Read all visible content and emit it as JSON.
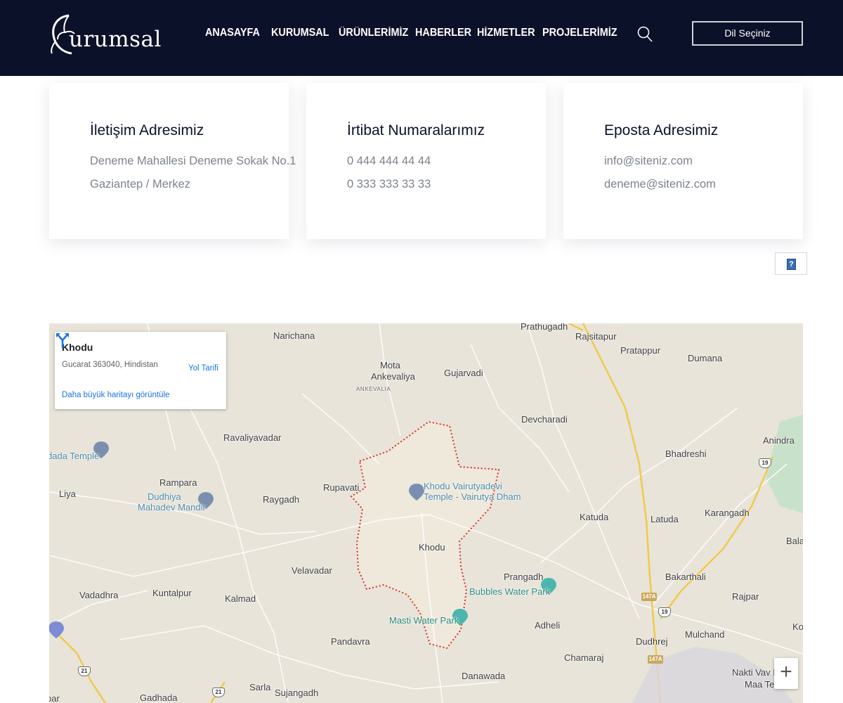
{
  "header": {
    "logo_text": "urumsal",
    "nav": [
      {
        "label": "ANASAYFA",
        "name": "nav-anasayfa"
      },
      {
        "label": "KURUMSAL",
        "name": "nav-kurumsal"
      },
      {
        "label": "ÜRÜNLERİMİZ",
        "name": "nav-urunlerimiz"
      },
      {
        "label": "HABERLER",
        "name": "nav-haberler"
      },
      {
        "label": "HİZMETLER",
        "name": "nav-hizmetler"
      },
      {
        "label": "PROJELERİMİZ",
        "name": "nav-projelerimiz"
      }
    ],
    "search_icon": "search-icon",
    "language_button": "Dil Seçiniz"
  },
  "cards": [
    {
      "title": "İletişim Adresimiz",
      "line1": "Deneme Mahallesi Deneme Sokak No.1",
      "line2": "Gaziantep / Merkez"
    },
    {
      "title": "İrtibat Numaralarımız",
      "line1": "0 444 444 44 44",
      "line2": "0 333 333 33 33"
    },
    {
      "title": "Eposta Adresimiz",
      "line1": "info@siteniz.com",
      "line2": "deneme@siteniz.com"
    }
  ],
  "help_icon": "help-icon",
  "map": {
    "info": {
      "title": "Khodu",
      "address": "Gucarat 363040, Hindistan",
      "directions_label": "Yol Tarifi",
      "larger_map_link": "Daha büyük haritayı görüntüle"
    },
    "zoom_in": "+",
    "places": {
      "prathugadh": "Prathugadh",
      "rajsitapur": "Rajsitapur",
      "narichana": "Narichana",
      "pratappur": "Pratappur",
      "dumana": "Dumana",
      "mota": "Mota",
      "ankevaliya": "Ankevaliya",
      "ankevalia_small": "ANKEVALIA",
      "gujarvadi": "Gujarvadi",
      "devcharadi": "Devcharadi",
      "ravaliyavadar": "Ravaliyavadar",
      "anindra": "Anindra",
      "dada_temple": "dada Temple",
      "bhadreshi": "Bhadreshi",
      "rampara": "Rampara",
      "liya": "Liya",
      "dudhiya_1": "Dudhiya",
      "dudhiya_2": "Mahadev Mandir",
      "raygadh": "Raygadh",
      "rupavati": "Rupavati",
      "khodu_temple_1": "Khodu Vairutyadevi",
      "khodu_temple_2": "Temple - Vairutya Dham",
      "karangadh": "Karangadh",
      "katuda": "Katuda",
      "latuda": "Latuda",
      "bala": "Bala",
      "khodu": "Khodu",
      "velavadar": "Velavadar",
      "prangadh": "Prangadh",
      "bakarthali": "Bakarthali",
      "vadadhra": "Vadadhra",
      "kuntalpur": "Kuntalpur",
      "kalmad": "Kalmad",
      "bubbles": "Bubbles Water Park",
      "rajpar": "Rajpar",
      "masti": "Masti Water Park",
      "adheli": "Adheli",
      "ko": "Ko",
      "mulchand": "Mulchand",
      "dudhrej": "Dudhrej",
      "pandavra": "Pandavra",
      "chamaraj": "Chamaraj",
      "danawada": "Danawada",
      "nakti_1": "Nakti Vav M",
      "nakti_2": "Maa Ter",
      "sarla": "Sarla",
      "sujangadh": "Sujangadh",
      "gadhada": "Gadhada",
      "bar": "bar"
    },
    "shields": {
      "h19a": "19",
      "h19b": "19",
      "h21a": "21",
      "h21b": "21",
      "h147a": "147A",
      "h147b": "147A"
    },
    "colors": {
      "map_bg": "#e8e4da",
      "boundary": "#d93025",
      "highway": "#f2c94c",
      "link": "#1a73e8"
    }
  }
}
